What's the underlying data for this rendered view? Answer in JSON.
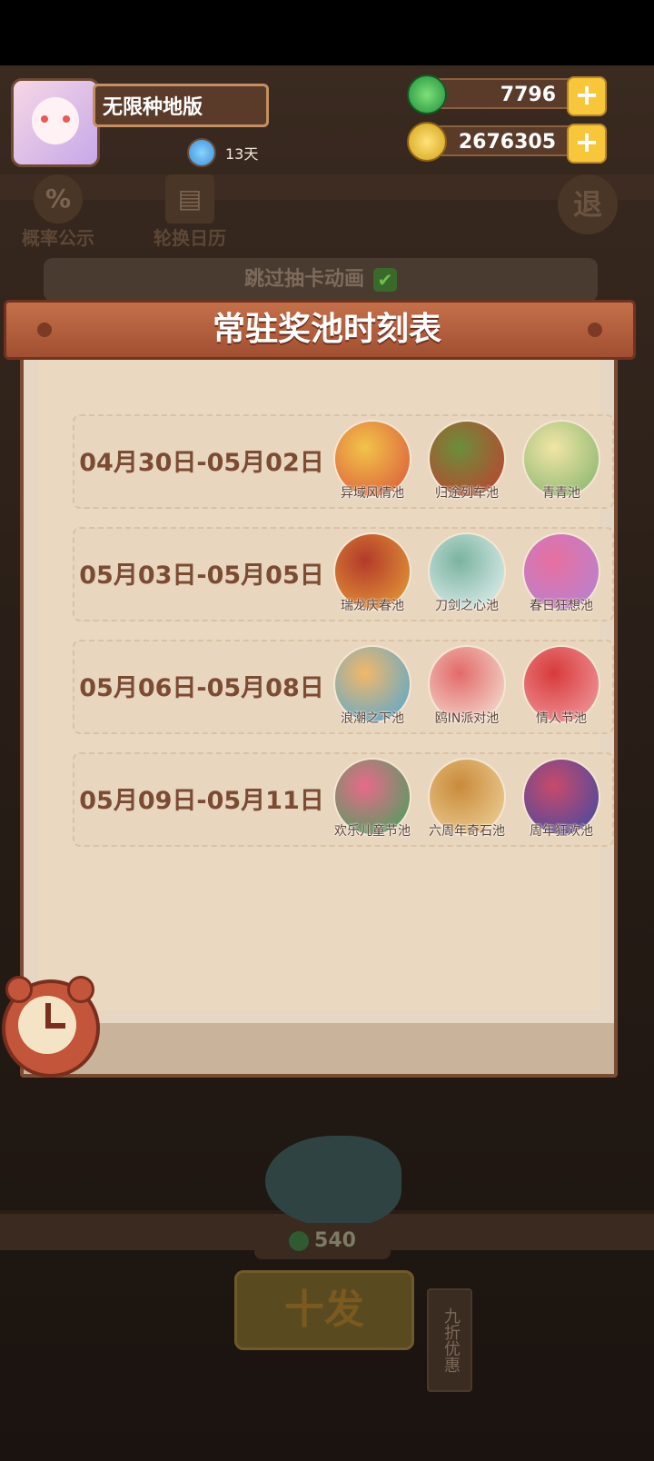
{
  "header": {
    "player_name": "无限种地版",
    "days_label": "13天",
    "jade_amount": "7796",
    "gold_amount": "2676305"
  },
  "toolbar": {
    "probability_label": "概率公示",
    "calendar_label": "轮换日历",
    "exit_label": "退"
  },
  "skip": {
    "label": "跳过抽卡动画"
  },
  "popup": {
    "title": "常驻奖池时刻表",
    "rows": [
      {
        "date_range": "04月30日-05月02日",
        "pools": [
          {
            "name": "异域风情池",
            "colors": [
              "#d9533a",
              "#f2c34a"
            ]
          },
          {
            "name": "归途列车池",
            "colors": [
              "#c63b2f",
              "#6a8f3a"
            ]
          },
          {
            "name": "青青池",
            "colors": [
              "#7fb26a",
              "#f1e5a6"
            ]
          }
        ]
      },
      {
        "date_range": "05月03日-05月05日",
        "pools": [
          {
            "name": "瑞龙庆春池",
            "colors": [
              "#e9a23a",
              "#b33a2a"
            ]
          },
          {
            "name": "刀剑之心池",
            "colors": [
              "#e8f4f6",
              "#7bb39f"
            ]
          },
          {
            "name": "春日狂想池",
            "colors": [
              "#b184d6",
              "#e86fa0"
            ]
          }
        ]
      },
      {
        "date_range": "05月06日-05月08日",
        "pools": [
          {
            "name": "浪潮之下池",
            "colors": [
              "#4aa6d8",
              "#f2b86a"
            ]
          },
          {
            "name": "鸥IN派对池",
            "colors": [
              "#f6e8da",
              "#e26a6a"
            ]
          },
          {
            "name": "情人节池",
            "colors": [
              "#f2a2a8",
              "#d83a3a"
            ]
          }
        ]
      },
      {
        "date_range": "05月09日-05月11日",
        "pools": [
          {
            "name": "欢乐儿童节池",
            "colors": [
              "#3aa65a",
              "#e86a8a"
            ]
          },
          {
            "name": "六周年奇石池",
            "colors": [
              "#f1d6a0",
              "#c98a3a"
            ]
          },
          {
            "name": "周年狂欢池",
            "colors": [
              "#3a4aa6",
              "#c84a6a"
            ]
          }
        ]
      }
    ]
  },
  "bottom": {
    "cost_amount": "540",
    "ten_draw_label": "十发",
    "discount_label": "九折优惠"
  }
}
